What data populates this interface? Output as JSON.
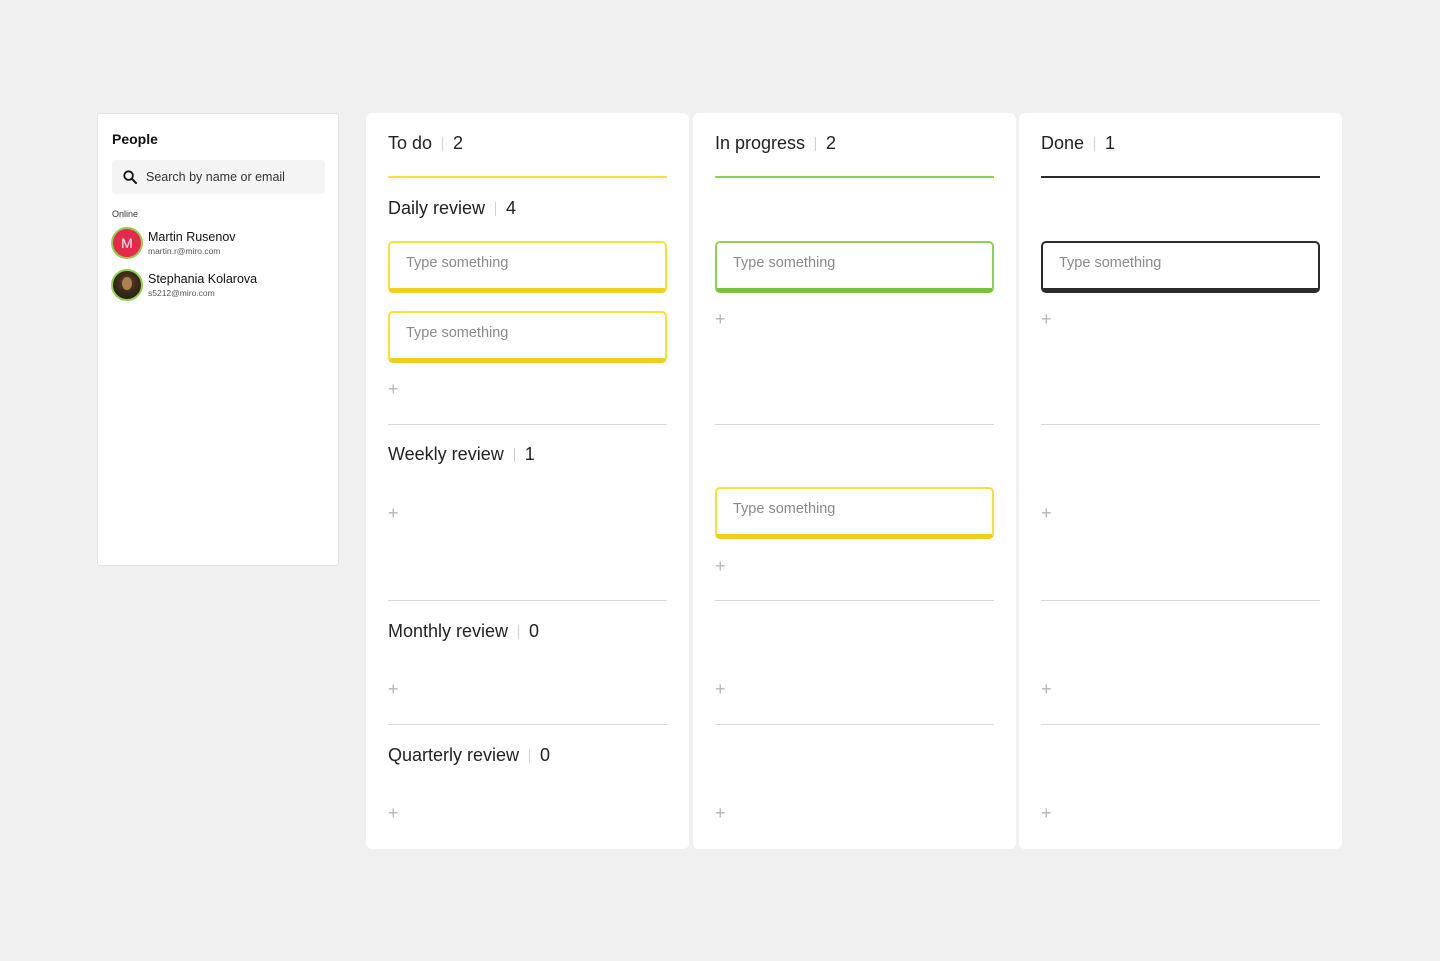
{
  "people": {
    "title": "People",
    "search_placeholder": "Search by name or email",
    "online_label": "Online",
    "users": [
      {
        "initial": "M",
        "name": "Martin Rusenov",
        "email": "martin.r@miro.com"
      },
      {
        "initial": "",
        "name": "Stephania Kolarova",
        "email": "s5212@miro.com"
      }
    ]
  },
  "columns": [
    {
      "title": "To do",
      "count": "2",
      "accent": "#f9e03a"
    },
    {
      "title": "In progress",
      "count": "2",
      "accent": "#8fd14f"
    },
    {
      "title": "Done",
      "count": "1",
      "accent": "#2b2b2b"
    }
  ],
  "rows": [
    {
      "title": "Daily review",
      "count": "4"
    },
    {
      "title": "Weekly review",
      "count": "1"
    },
    {
      "title": "Monthly review",
      "count": "0"
    },
    {
      "title": "Quarterly review",
      "count": "0"
    }
  ],
  "card_placeholder": "Type something",
  "add_icon": "plus-icon"
}
